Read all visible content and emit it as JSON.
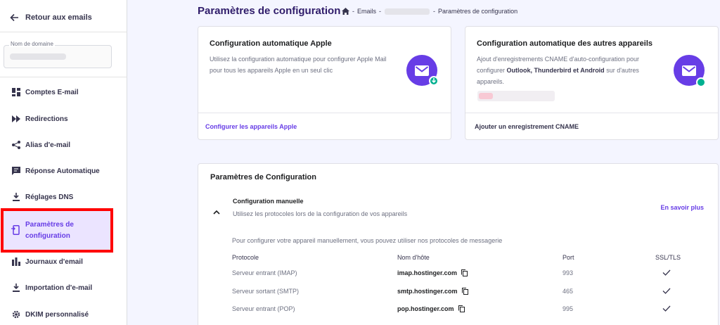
{
  "sidebar": {
    "back_label": "Retour aux emails",
    "domain_label": "Nom de domaine",
    "items": [
      {
        "label": "Comptes E-mail",
        "icon": "dashboard-icon"
      },
      {
        "label": "Redirections",
        "icon": "fast-forward-icon"
      },
      {
        "label": "Alias d'e-mail",
        "icon": "share-icon"
      },
      {
        "label": "Réponse Automatique",
        "icon": "chat-icon"
      },
      {
        "label": "Réglages DNS",
        "icon": "download-icon"
      },
      {
        "label": "Paramètres de configuration",
        "icon": "device-config-icon",
        "active": true
      },
      {
        "label": "Journaux d'email",
        "icon": "bar-chart-icon"
      },
      {
        "label": "Importation d'e-mail",
        "icon": "import-icon"
      },
      {
        "label": "DKIM personnalisé",
        "icon": "gear-icon"
      }
    ]
  },
  "header": {
    "title": "Paramètres de configuration",
    "breadcrumb": [
      "Emails",
      "Paramètres de configuration"
    ]
  },
  "apple_card": {
    "title": "Configuration automatique Apple",
    "text": "Utilisez la configuration automatique pour configurer Apple Mail pour tous les appareils Apple en un seul clic",
    "link": "Configurer les appareils Apple"
  },
  "other_card": {
    "title": "Configuration automatique des autres appareils",
    "text_pre": "Ajout d'enregistrements CNAME d'auto-configuration pour configurer ",
    "text_bold": "Outlook, Thunderbird et Android",
    "text_post": " sur d'autres appareils.",
    "link": "Ajouter un enregistrement CNAME"
  },
  "config": {
    "title": "Paramètres de Configuration",
    "manual_title": "Configuration manuelle",
    "manual_sub": "Utilisez les protocoles lors de la configuration de vos appareils",
    "learn_more": "En savoir plus",
    "intro": "Pour configurer votre appareil manuellement, vous pouvez utiliser nos protocoles de messagerie",
    "headers": {
      "protocol": "Protocole",
      "host": "Nom d'hôte",
      "port": "Port",
      "ssl": "SSL/TLS"
    },
    "rows": [
      {
        "protocol": "Serveur entrant (IMAP)",
        "host": "imap.hostinger.com",
        "port": "993"
      },
      {
        "protocol": "Serveur sortant (SMTP)",
        "host": "smtp.hostinger.com",
        "port": "465"
      },
      {
        "protocol": "Serveur entrant (POP)",
        "host": "pop.hostinger.com",
        "port": "995"
      }
    ]
  },
  "colors": {
    "accent": "#673de6",
    "green": "#00b090",
    "highlight": "#ff0000"
  }
}
